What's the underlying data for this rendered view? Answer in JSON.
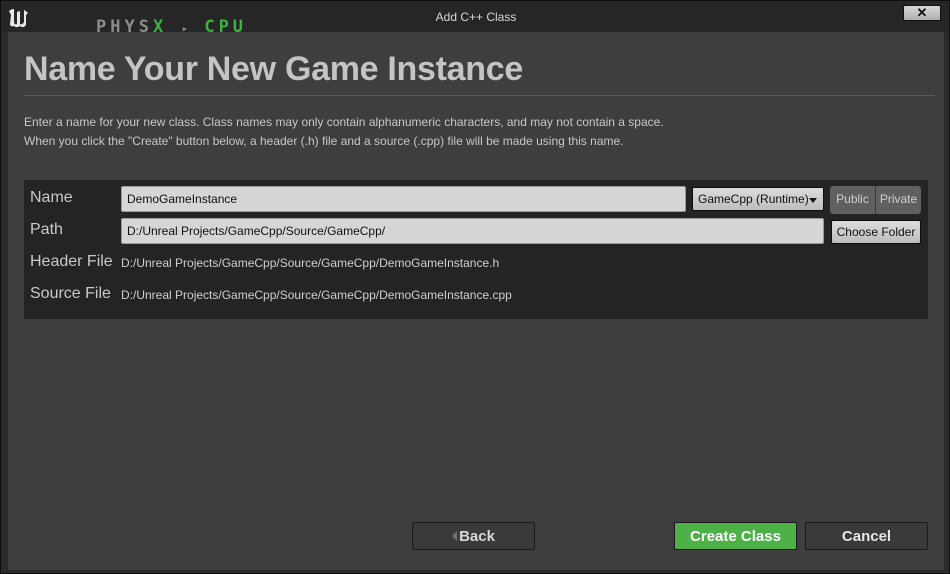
{
  "window": {
    "title": "Add C++ Class",
    "close_label": "✕"
  },
  "overlay": {
    "physx": "PHYS",
    "x": "X",
    "arrow": "▸",
    "cpu": "CPU"
  },
  "page": {
    "heading": "Name Your New Game Instance",
    "description_line1": "Enter a name for your new class. Class names may only contain alphanumeric characters, and may not contain a space.",
    "description_line2": "When you click the \"Create\" button below, a header (.h) file and a source (.cpp) file will be made using this name."
  },
  "form": {
    "name_label": "Name",
    "name_value": "DemoGameInstance",
    "module_select": "GameCpp (Runtime)",
    "visibility": {
      "public_label": "Public",
      "private_label": "Private"
    },
    "path_label": "Path",
    "path_value": "D:/Unreal Projects/GameCpp/Source/GameCpp/",
    "choose_folder_label": "Choose Folder",
    "header_label": "Header File",
    "header_value": "D:/Unreal Projects/GameCpp/Source/GameCpp/DemoGameInstance.h",
    "source_label": "Source File",
    "source_value": "D:/Unreal Projects/GameCpp/Source/GameCpp/DemoGameInstance.cpp"
  },
  "footer": {
    "back_label": "Back",
    "create_label": "Create Class",
    "cancel_label": "Cancel"
  },
  "colors": {
    "accent_green": "#4db148",
    "background": "#3e3e3e",
    "panel": "#242424"
  }
}
